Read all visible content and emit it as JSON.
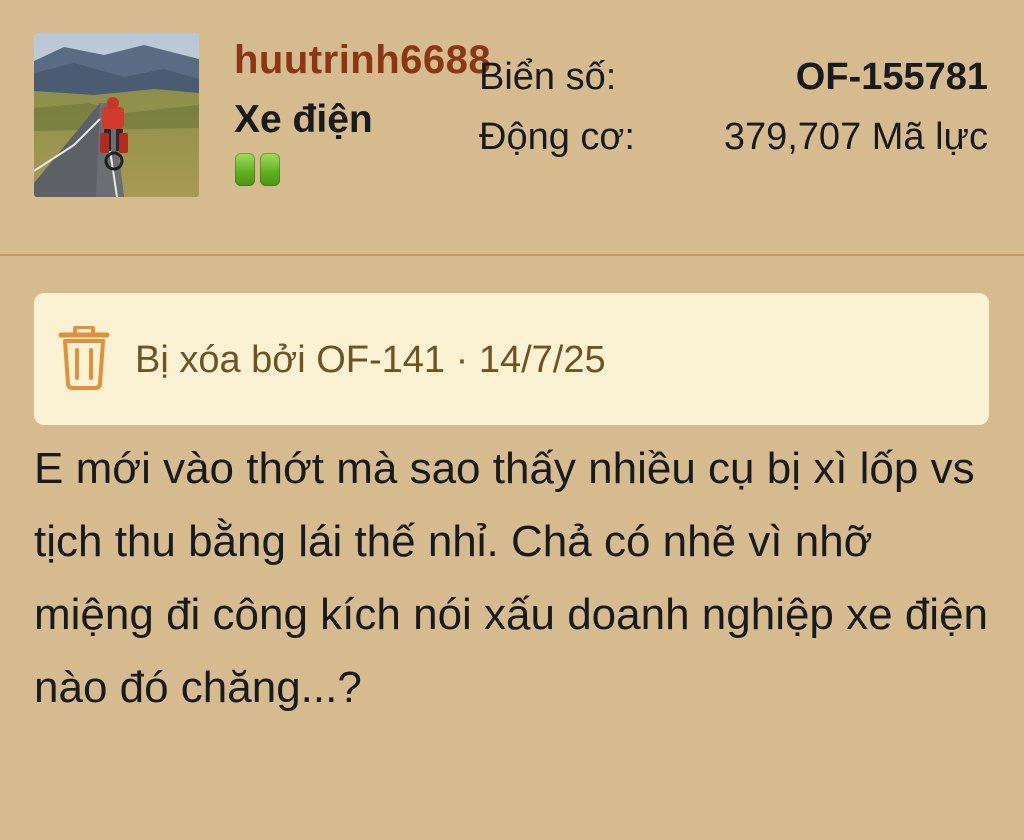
{
  "post": {
    "author": {
      "username": "huutrinh6688",
      "title": "Xe điện",
      "badge_count": 2,
      "badge_color": "#6fbf2a",
      "avatar": "cyclist-on-mountain-road-photo"
    },
    "stats": {
      "plate_label": "Biển số:",
      "plate_value": "OF-155781",
      "engine_label": "Động cơ:",
      "engine_value": "379,707 Mã lực"
    },
    "deleted_notice": {
      "icon": "trash-icon",
      "text": "Bị xóa bởi OF-141 · 14/7/25"
    },
    "message": "E mới vào thớt mà sao thấy nhiều cụ bị xì lốp vs tịch thu bằng lái thế nhỉ. Chả có nhẽ vì nhỡ miệng đi công kích nói xấu doanh nghiệp xe điện nào đó chăng...?"
  },
  "colors": {
    "background": "#d5bb8d",
    "username": "#8b3716",
    "notice_bg": "#fbf1d3",
    "notice_text": "#6e5323",
    "trash_icon": "#e0913a",
    "divider": "#c49d56"
  }
}
